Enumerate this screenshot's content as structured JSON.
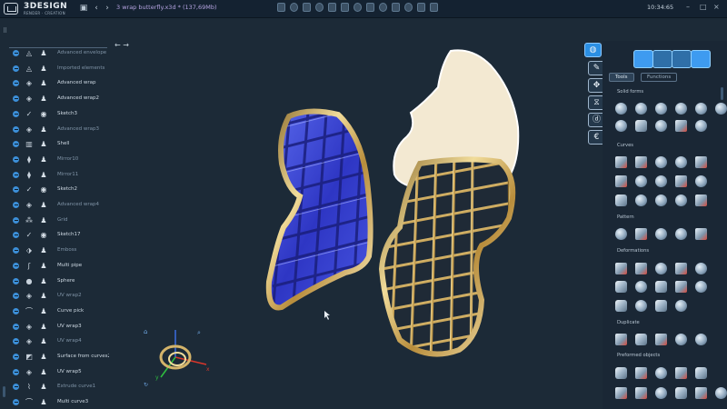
{
  "app": {
    "logo_name": "3DESIGN",
    "logo_tagline": "RENDER · CREATION",
    "file_name": "3 wrap butterfly.x3d *",
    "file_size": "(137,69Mb)",
    "clock": "10:34:65"
  },
  "colors": {
    "background": "#1c2a37",
    "accent": "#2b8fe3",
    "gold": "#d4b46a",
    "lattice_blue": "#3446d6",
    "shape_cream": "#f3e9d2"
  },
  "tree": {
    "items": [
      {
        "label": "Advanced envelope",
        "icon": "ring-icon",
        "dim": true
      },
      {
        "label": "Imported elements",
        "icon": "ring-icon",
        "dim": true
      },
      {
        "label": "Advanced wrap",
        "icon": "wrap-icon",
        "dim": false
      },
      {
        "label": "Advanced wrap2",
        "icon": "wrap-icon",
        "dim": false
      },
      {
        "label": "Sketch3",
        "icon": "sketch-icon",
        "dim": false
      },
      {
        "label": "Advanced wrap3",
        "icon": "wrap-icon",
        "dim": true
      },
      {
        "label": "Shell",
        "icon": "shell-icon",
        "dim": false
      },
      {
        "label": "Mirror10",
        "icon": "mirror-icon",
        "dim": true
      },
      {
        "label": "Mirror11",
        "icon": "mirror-icon",
        "dim": true
      },
      {
        "label": "Sketch2",
        "icon": "sketch-icon",
        "dim": false
      },
      {
        "label": "Advanced wrap4",
        "icon": "wrap-icon",
        "dim": true
      },
      {
        "label": "Grid",
        "icon": "grid-icon",
        "dim": true
      },
      {
        "label": "Sketch17",
        "icon": "sketch-icon",
        "dim": false
      },
      {
        "label": "Emboss",
        "icon": "emboss-icon",
        "dim": true
      },
      {
        "label": "Multi pipe",
        "icon": "pipe-icon",
        "dim": false
      },
      {
        "label": "Sphere",
        "icon": "sphere-icon",
        "dim": false
      },
      {
        "label": "UV wrap2",
        "icon": "wrap-icon",
        "dim": true
      },
      {
        "label": "Curve pick",
        "icon": "curve-icon",
        "dim": false
      },
      {
        "label": "UV wrap3",
        "icon": "wrap-icon",
        "dim": false
      },
      {
        "label": "UV wrap4",
        "icon": "wrap-icon",
        "dim": true
      },
      {
        "label": "Surface from curves2",
        "icon": "surface-icon",
        "dim": false
      },
      {
        "label": "UV wrap5",
        "icon": "wrap-icon",
        "dim": false
      },
      {
        "label": "Extrude curve1",
        "icon": "extrude-icon",
        "dim": true
      },
      {
        "label": "Multi curve3",
        "icon": "curve-icon",
        "dim": false
      }
    ]
  },
  "panel": {
    "tabs": [
      "Tools",
      "Functions"
    ],
    "sections": [
      "Solid forms",
      "Curves",
      "Pattern",
      "Deformations",
      "Duplicate",
      "Preformed objects"
    ]
  },
  "gizmo": {
    "axis_x": "x",
    "axis_y": "y"
  }
}
